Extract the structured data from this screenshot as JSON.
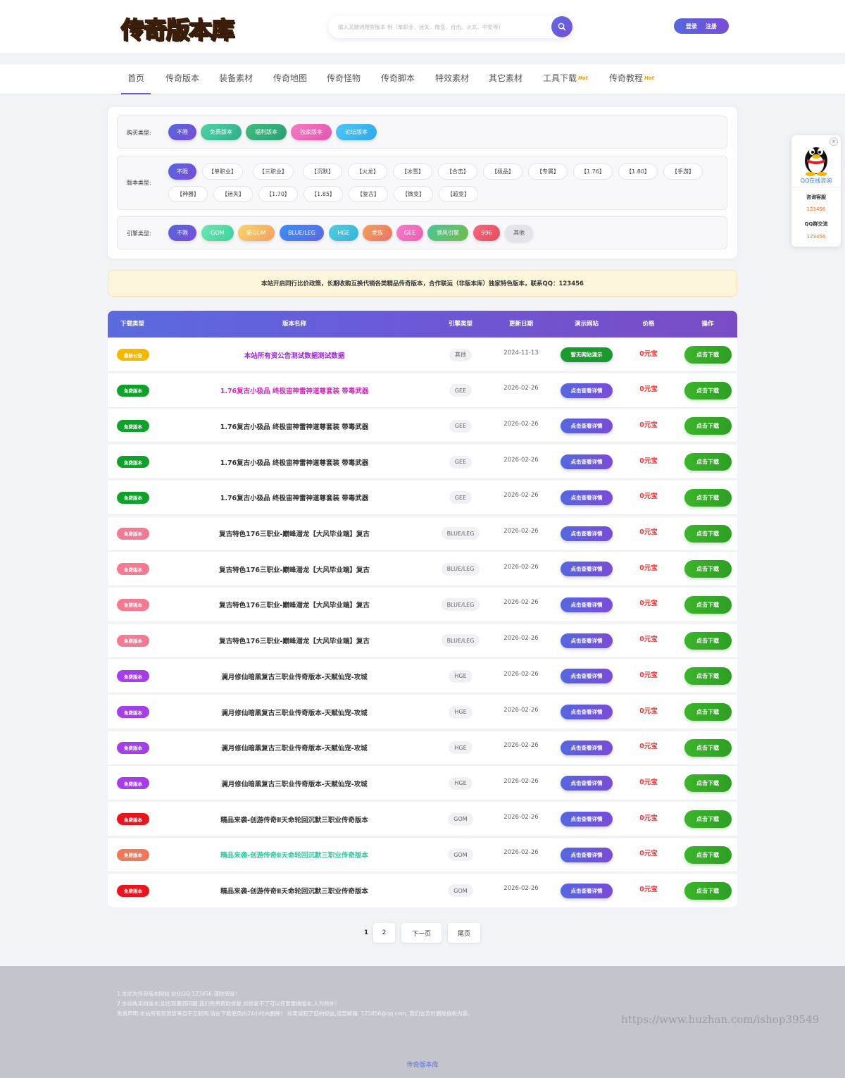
{
  "header": {
    "logo_text": "传奇版本库",
    "search_placeholder": "输入关键词搜索版本 例（单职业、迷失、微变、合击、火龙、中变等）",
    "login": "登录",
    "register": "注册"
  },
  "nav": {
    "items": [
      "首页",
      "传奇版本",
      "装备素材",
      "传奇地图",
      "传奇怪物",
      "传奇脚本",
      "特效素材",
      "其它素材",
      "工具下载",
      "传奇教程"
    ],
    "hot_label": "Hot"
  },
  "filters": {
    "buy_label": "购买类型:",
    "buy_options": [
      "不限",
      "免费版本",
      "福利版本",
      "独家版本",
      "论坛版本"
    ],
    "version_label": "版本类型:",
    "version_options": [
      "不限",
      "【单职业】",
      "【三职业】",
      "【沉默】",
      "【火龙】",
      "【冰雪】",
      "【合击】",
      "【极品】",
      "【专属】",
      "【1.76】",
      "【1.80】",
      "【手游】",
      "【神器】",
      "【迷失】",
      "【1.70】",
      "【1.85】",
      "【复古】",
      "【微变】",
      "【超变】"
    ],
    "engine_label": "引擎类型:",
    "engine_options": [
      "不限",
      "GOM",
      "新GOM",
      "BLUE/LEG",
      "HGE",
      "龙族",
      "GEE",
      "领风引擎",
      "996",
      "其他"
    ]
  },
  "notice": "本站开启同行比价政策，长期收购互换代销各类精品传奇版本，合作联运（非版本库）独家特色版本，联系QQ：123456",
  "table": {
    "headers": [
      "下载类型",
      "版本名称",
      "引擎类型",
      "更新日期",
      "演示网站",
      "价格",
      "操作"
    ],
    "download_label": "点击下载",
    "rows": [
      {
        "type": "最新公告",
        "type_color": "#f5b800",
        "name": "本站所有资公告测试数据测试数据",
        "name_color": "#9b2bd6",
        "engine": "其他",
        "date": "2024-11-13",
        "demo": "暂无网站演示",
        "demo_green": true,
        "price": "0元宝"
      },
      {
        "type": "免费版本",
        "type_color": "#11a02c",
        "name": "1.76复古小极品 终极宙神雷神道尊套装 带毒武器",
        "name_color": "#d22bbf",
        "engine": "GEE",
        "date": "2026-02-26",
        "demo": "点击查看详情",
        "demo_green": false,
        "price": "0元宝"
      },
      {
        "type": "免费版本",
        "type_color": "#11a02c",
        "name": "1.76复古小极品 终极宙神雷神道尊套装 带毒武器",
        "name_color": "#333333",
        "engine": "GEE",
        "date": "2026-02-26",
        "demo": "点击查看详情",
        "demo_green": false,
        "price": "0元宝"
      },
      {
        "type": "免费版本",
        "type_color": "#11a02c",
        "name": "1.76复古小极品 终极宙神雷神道尊套装 带毒武器",
        "name_color": "#333333",
        "engine": "GEE",
        "date": "2026-02-26",
        "demo": "点击查看详情",
        "demo_green": false,
        "price": "0元宝"
      },
      {
        "type": "免费版本",
        "type_color": "#11a02c",
        "name": "1.76复古小极品 终极宙神雷神道尊套装 带毒武器",
        "name_color": "#333333",
        "engine": "GEE",
        "date": "2026-02-26",
        "demo": "点击查看详情",
        "demo_green": false,
        "price": "0元宝"
      },
      {
        "type": "免费版本",
        "type_color": "#f27a92",
        "name": "复古特色176三职业-巅峰潜龙【大风毕业端】复古",
        "name_color": "#333333",
        "engine": "BLUE/LEG",
        "date": "2026-02-26",
        "demo": "点击查看详情",
        "demo_green": false,
        "price": "0元宝"
      },
      {
        "type": "免费版本",
        "type_color": "#f27a92",
        "name": "复古特色176三职业-巅峰潜龙【大风毕业端】复古",
        "name_color": "#333333",
        "engine": "BLUE/LEG",
        "date": "2026-02-26",
        "demo": "点击查看详情",
        "demo_green": false,
        "price": "0元宝"
      },
      {
        "type": "免费版本",
        "type_color": "#f27a92",
        "name": "复古特色176三职业-巅峰潜龙【大风毕业端】复古",
        "name_color": "#333333",
        "engine": "BLUE/LEG",
        "date": "2026-02-26",
        "demo": "点击查看详情",
        "demo_green": false,
        "price": "0元宝"
      },
      {
        "type": "免费版本",
        "type_color": "#f27a92",
        "name": "复古特色176三职业-巅峰潜龙【大风毕业端】复古",
        "name_color": "#333333",
        "engine": "BLUE/LEG",
        "date": "2026-02-26",
        "demo": "点击查看详情",
        "demo_green": false,
        "price": "0元宝"
      },
      {
        "type": "免费版本",
        "type_color": "#a43ee6",
        "name": "澜月修仙暗黑复古三职业传奇版本-天赋仙宠-攻城",
        "name_color": "#333333",
        "engine": "HGE",
        "date": "2026-02-26",
        "demo": "点击查看详情",
        "demo_green": false,
        "price": "0元宝"
      },
      {
        "type": "免费版本",
        "type_color": "#a43ee6",
        "name": "澜月修仙暗黑复古三职业传奇版本-天赋仙宠-攻城",
        "name_color": "#333333",
        "engine": "HGE",
        "date": "2026-02-26",
        "demo": "点击查看详情",
        "demo_green": false,
        "price": "0元宝"
      },
      {
        "type": "免费版本",
        "type_color": "#a43ee6",
        "name": "澜月修仙暗黑复古三职业传奇版本-天赋仙宠-攻城",
        "name_color": "#333333",
        "engine": "HGE",
        "date": "2026-02-26",
        "demo": "点击查看详情",
        "demo_green": false,
        "price": "0元宝"
      },
      {
        "type": "免费版本",
        "type_color": "#a43ee6",
        "name": "澜月修仙暗黑复古三职业传奇版本-天赋仙宠-攻城",
        "name_color": "#333333",
        "engine": "HGE",
        "date": "2026-02-26",
        "demo": "点击查看详情",
        "demo_green": false,
        "price": "0元宝"
      },
      {
        "type": "免费版本",
        "type_color": "#e8141e",
        "name": "精品来袭-创游传奇Ⅱ天命轮回沉默三职业传奇版本",
        "name_color": "#333333",
        "engine": "GOM",
        "date": "2026-02-26",
        "demo": "点击查看详情",
        "demo_green": false,
        "price": "0元宝"
      },
      {
        "type": "免费版本",
        "type_color": "#f0785a",
        "name": "精品来袭-创游传奇Ⅱ天命轮回沉默三职业传奇版本",
        "name_color": "#2ec7a0",
        "engine": "GOM",
        "date": "2026-02-26",
        "demo": "点击查看详情",
        "demo_green": false,
        "price": "0元宝"
      },
      {
        "type": "免费版本",
        "type_color": "#e8141e",
        "name": "精品来袭-创游传奇Ⅱ天命轮回沉默三职业传奇版本",
        "name_color": "#333333",
        "engine": "GOM",
        "date": "2026-02-26",
        "demo": "点击查看详情",
        "demo_green": false,
        "price": "0元宝"
      }
    ]
  },
  "pagination": {
    "current": "1",
    "page2": "2",
    "next": "下一页",
    "last": "尾页"
  },
  "footer": {
    "lines": [
      "1.本站为传奇版本网站 站长QQ:123456 谨防假冒！",
      "2.本站购买的版本,如出现漏洞问题,我们免费帮助修复,如修复不了可以任意更换版本,人为除外！",
      "免责声明:本站所有资源皆来自于互联网,请在下载使用内24小时内删除！ 如果侵犯了您的权益,请至邮箱: 123456@qq.com, 我们会及时删除侵权内容。"
    ],
    "watermark": "https://www.huzhan.com/ishop39549",
    "site_link": "传奇版本库"
  },
  "qq_float": {
    "title": "QQ在线咨询",
    "service_label": "咨询客服",
    "service_qq": "123456",
    "group_label": "QQ群交流",
    "group_qq": "123456",
    "close": "×"
  }
}
